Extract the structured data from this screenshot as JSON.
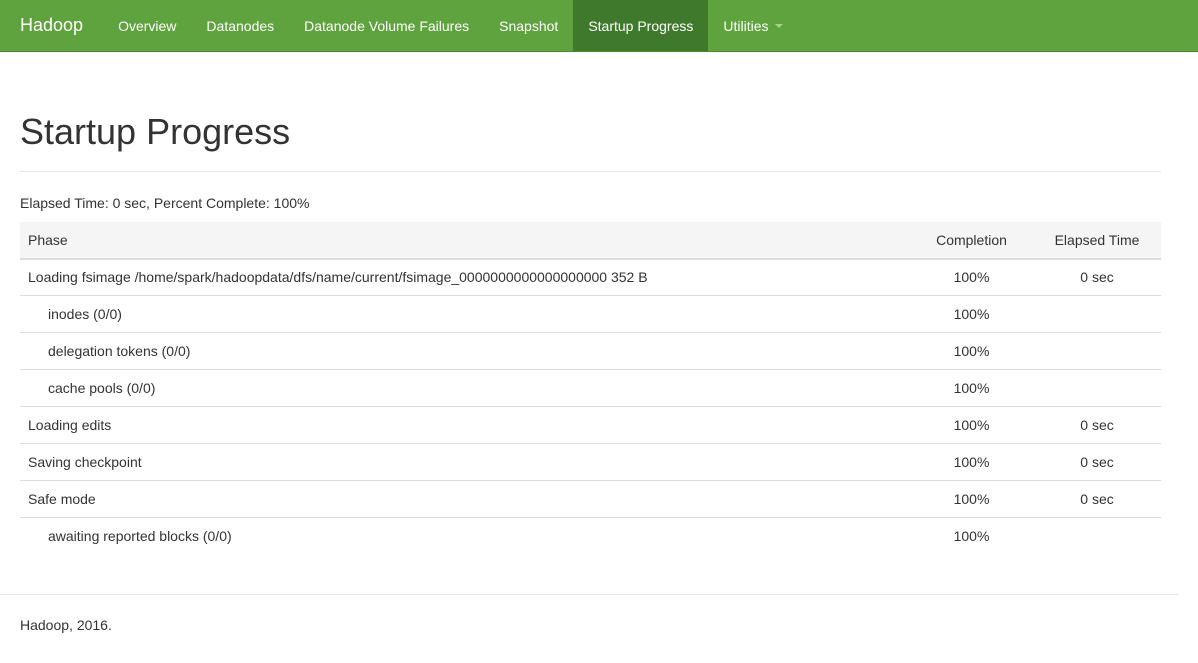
{
  "navbar": {
    "brand": "Hadoop",
    "items": [
      {
        "label": "Overview",
        "active": false
      },
      {
        "label": "Datanodes",
        "active": false
      },
      {
        "label": "Datanode Volume Failures",
        "active": false
      },
      {
        "label": "Snapshot",
        "active": false
      },
      {
        "label": "Startup Progress",
        "active": true
      },
      {
        "label": "Utilities",
        "active": false,
        "dropdown": true
      }
    ],
    "color": "#5fa33e",
    "active_color": "#3f7a2c"
  },
  "page": {
    "title": "Startup Progress",
    "summary": "Elapsed Time: 0 sec, Percent Complete: 100%"
  },
  "table": {
    "columns": [
      "Phase",
      "Completion",
      "Elapsed Time"
    ],
    "rows": [
      {
        "phase": "Loading fsimage /home/spark/hadoopdata/dfs/name/current/fsimage_0000000000000000000 352 B",
        "completion": "100%",
        "elapsed": "0 sec",
        "sub": false
      },
      {
        "phase": "inodes (0/0)",
        "completion": "100%",
        "elapsed": "",
        "sub": true
      },
      {
        "phase": "delegation tokens (0/0)",
        "completion": "100%",
        "elapsed": "",
        "sub": true
      },
      {
        "phase": "cache pools (0/0)",
        "completion": "100%",
        "elapsed": "",
        "sub": true
      },
      {
        "phase": "Loading edits",
        "completion": "100%",
        "elapsed": "0 sec",
        "sub": false
      },
      {
        "phase": "Saving checkpoint",
        "completion": "100%",
        "elapsed": "0 sec",
        "sub": false
      },
      {
        "phase": "Safe mode",
        "completion": "100%",
        "elapsed": "0 sec",
        "sub": false
      },
      {
        "phase": "awaiting reported blocks (0/0)",
        "completion": "100%",
        "elapsed": "",
        "sub": true
      }
    ]
  },
  "footer": {
    "text": "Hadoop, 2016."
  }
}
